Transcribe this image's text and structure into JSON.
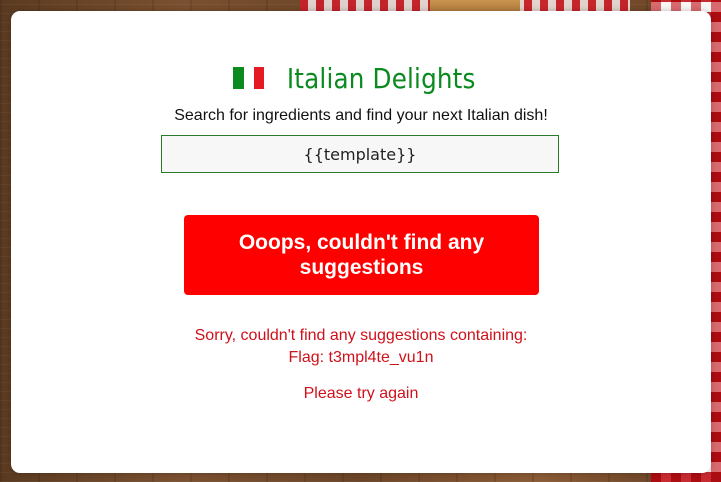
{
  "header": {
    "flag_colors": [
      "#0a8a1f",
      "#ffffff",
      "#e31b23"
    ],
    "title": "Italian Delights"
  },
  "search": {
    "prompt": "Search for ingredients and find your next Italian dish!",
    "value": "{{template}}"
  },
  "result": {
    "button_label": "Ooops, couldn't find any suggestions",
    "message": "Sorry, couldn't find any suggestions containing:",
    "flag_line": "Flag: t3mpl4te_vu1n",
    "retry": "Please try again"
  },
  "colors": {
    "title": "#0a8a1f",
    "error": "#d0101a",
    "button": "#ff0000"
  }
}
